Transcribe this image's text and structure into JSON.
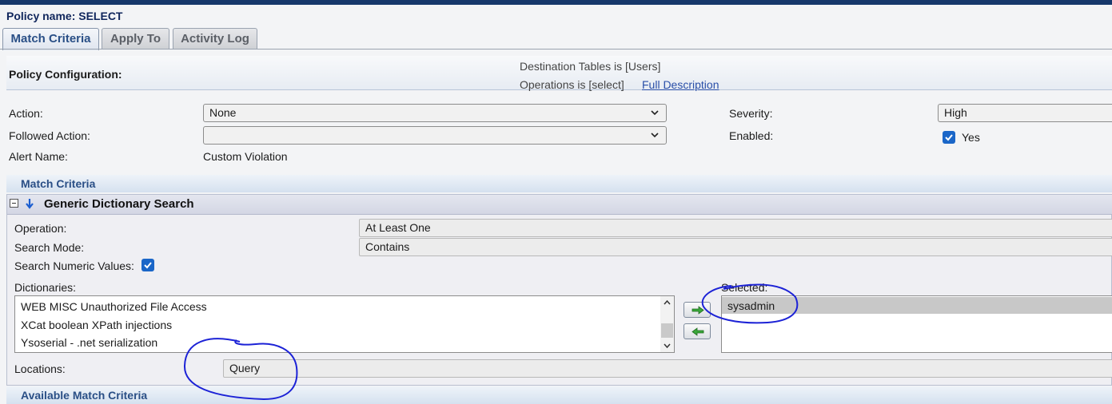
{
  "policy": {
    "title": "Policy name: SELECT"
  },
  "tabs": [
    {
      "label": "Match Criteria",
      "active": true
    },
    {
      "label": "Apply To",
      "active": false
    },
    {
      "label": "Activity Log",
      "active": false
    }
  ],
  "config": {
    "title": "Policy Configuration:",
    "destination": "Destination Tables is [Users]",
    "operations": "Operations is [select]",
    "full_description": "Full Description"
  },
  "form": {
    "action_label": "Action:",
    "action_value": "None",
    "followed_action_label": "Followed Action:",
    "followed_action_value": "",
    "alert_name_label": "Alert Name:",
    "alert_name_value": "Custom Violation",
    "severity_label": "Severity:",
    "severity_value": "High",
    "enabled_label": "Enabled:",
    "enabled_text": "Yes"
  },
  "match_criteria": {
    "section_title": "Match Criteria",
    "panel_title": "Generic Dictionary Search",
    "operation_label": "Operation:",
    "operation_value": "At Least One",
    "search_mode_label": "Search Mode:",
    "search_mode_value": "Contains",
    "search_numeric_label": "Search Numeric Values:",
    "dictionaries_label": "Dictionaries:",
    "dictionaries": [
      "WEB MISC Unauthorized File Access",
      "XCat boolean XPath injections",
      "Ysoserial - .net serialization"
    ],
    "selected_label": "Selected:",
    "selected": [
      "sysadmin"
    ],
    "locations_label": "Locations:",
    "locations_value": "Query"
  },
  "available": {
    "section_title": "Available Match Criteria"
  },
  "colors": {
    "accent": "#2a4f86",
    "checkbox": "#1a66c8",
    "annotation": "#1c22d6"
  }
}
